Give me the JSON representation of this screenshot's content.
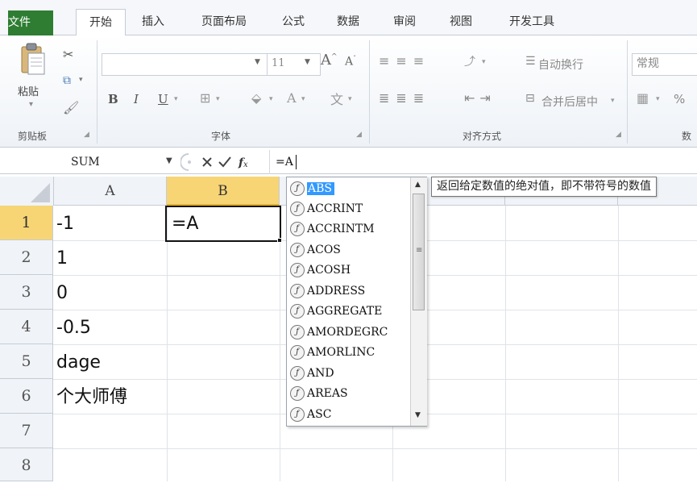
{
  "ribbon_tabs": [
    {
      "label": "文件"
    },
    {
      "label": "开始"
    },
    {
      "label": "插入"
    },
    {
      "label": "页面布局"
    },
    {
      "label": "公式"
    },
    {
      "label": "数据"
    },
    {
      "label": "审阅"
    },
    {
      "label": "视图"
    },
    {
      "label": "开发工具"
    }
  ],
  "clipboard": {
    "paste_label": "粘贴",
    "group_label": "剪贴板"
  },
  "font": {
    "size": "11",
    "group_label": "字体",
    "bold": "B",
    "italic": "I",
    "underline": "U"
  },
  "alignment": {
    "wrap_label": "自动换行",
    "merge_label": "合并后居中",
    "group_label": "对齐方式"
  },
  "number": {
    "format": "常规",
    "group_label": "数",
    "percent": "%"
  },
  "formula_bar": {
    "name_box": "SUM",
    "formula": "=A",
    "fx_label": "fx"
  },
  "columns": [
    "A",
    "B"
  ],
  "rows": [
    "1",
    "2",
    "3",
    "4",
    "5",
    "6",
    "7",
    "8"
  ],
  "cells_a": [
    "-1",
    "1",
    "0",
    "-0.5",
    "dage",
    "个大师傅"
  ],
  "active_cell": {
    "value": "=A"
  },
  "autocomplete": [
    "ABS",
    "ACCRINT",
    "ACCRINTM",
    "ACOS",
    "ACOSH",
    "ADDRESS",
    "AGGREGATE",
    "AMORDEGRC",
    "AMORLINC",
    "AND",
    "AREAS",
    "ASC"
  ],
  "tooltip": "返回给定数值的绝对值，即不带符号的数值",
  "colors": {
    "file_tab": "#2e7d32",
    "active_col_header": "#f7d575",
    "selection": "#3399ff"
  }
}
